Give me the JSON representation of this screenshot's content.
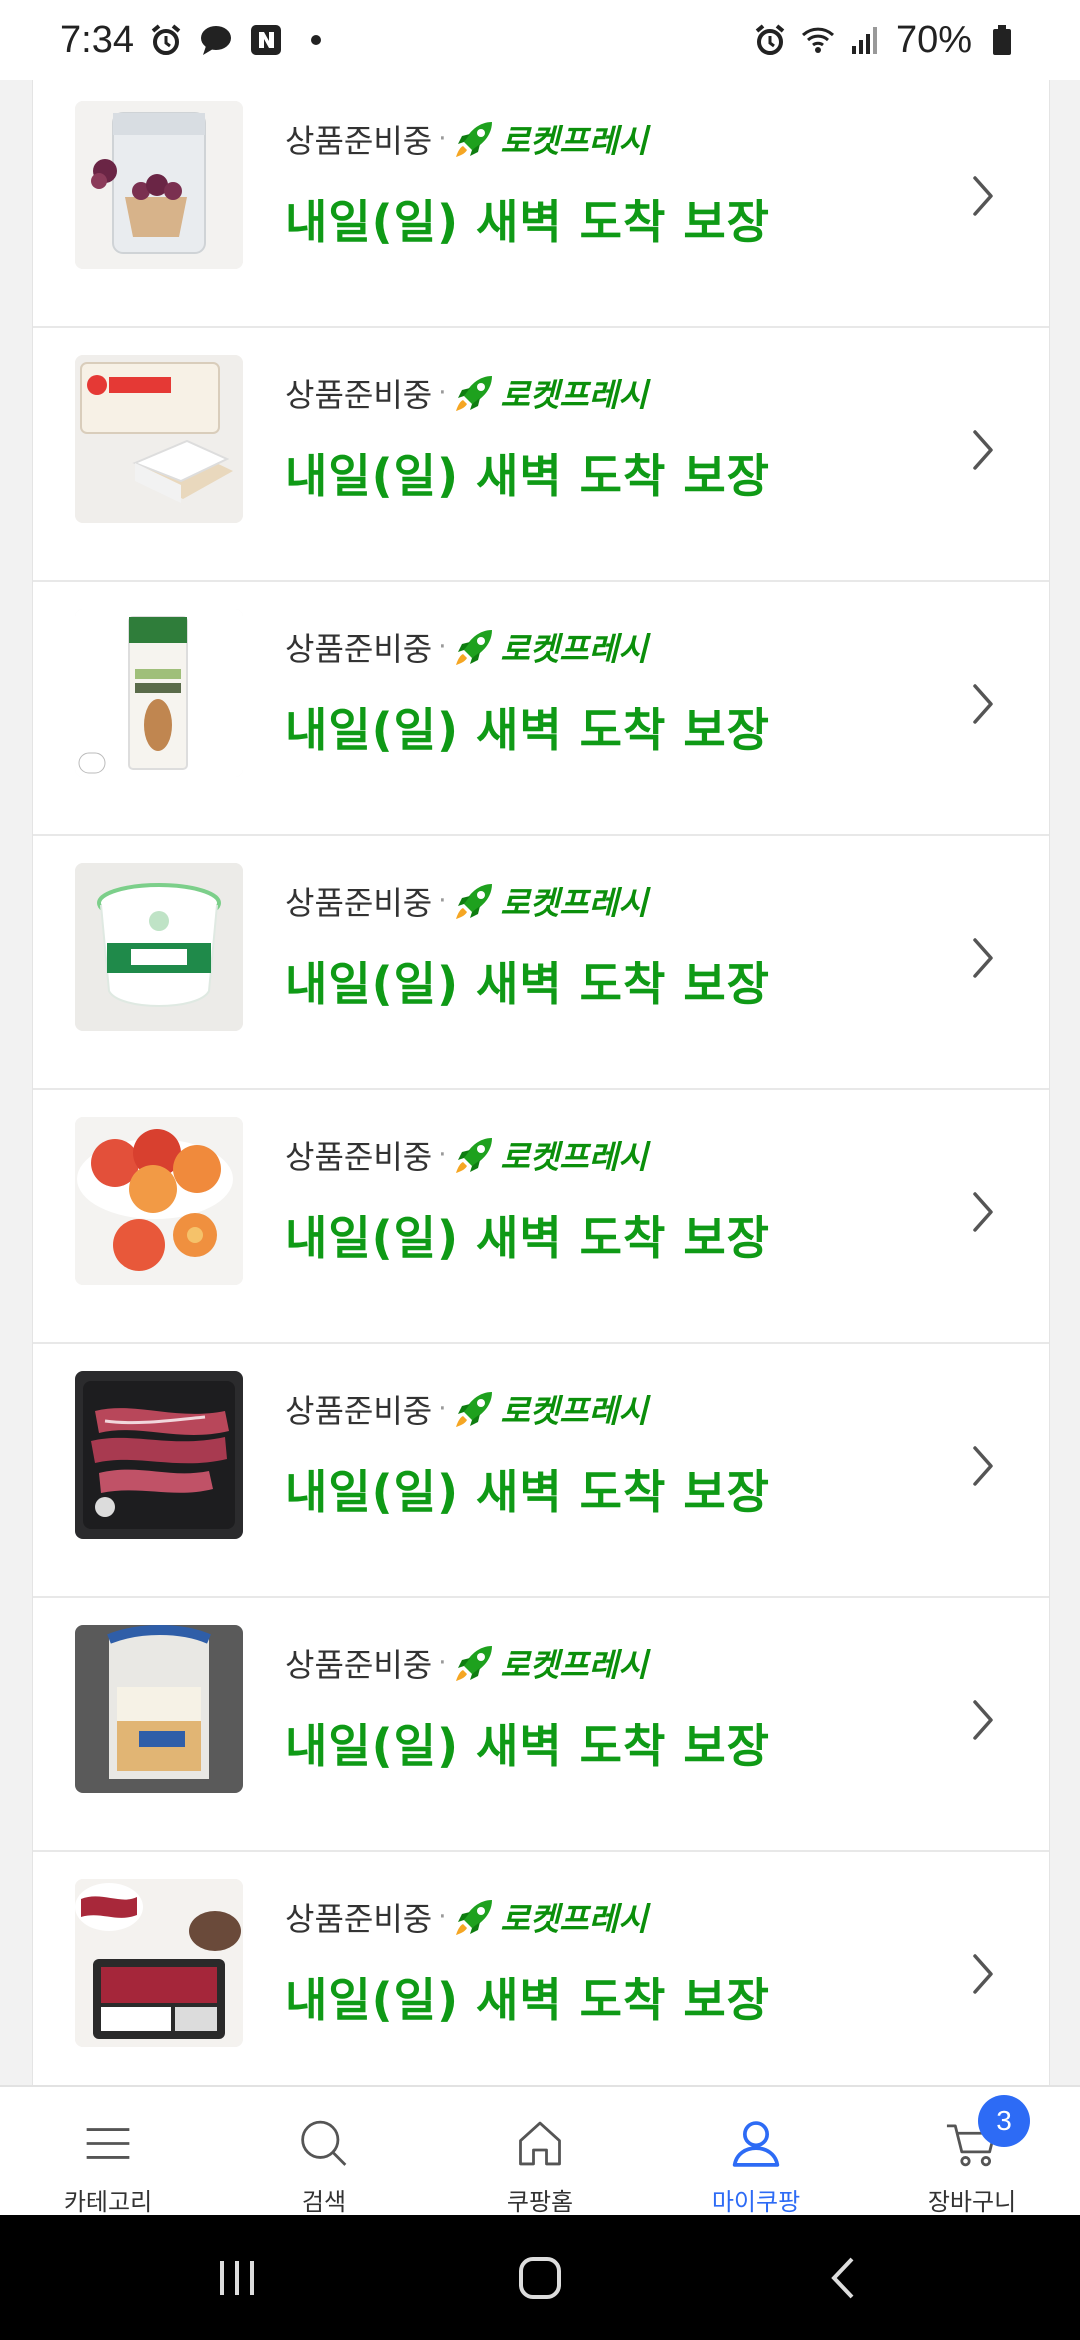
{
  "status_bar": {
    "time": "7:34",
    "battery": "70%"
  },
  "items": [
    {
      "status": "상품준비중",
      "badge": "로켓프레시",
      "delivery": "내일(일) 새벽 도착 보장",
      "thumb_icon": "rice-bag-product-image"
    },
    {
      "status": "상품준비중",
      "badge": "로켓프레시",
      "delivery": "내일(일) 새벽 도착 보장",
      "thumb_icon": "tofu-product-image"
    },
    {
      "status": "상품준비중",
      "badge": "로켓프레시",
      "delivery": "내일(일) 새벽 도착 보장",
      "thumb_icon": "almond-milk-product-image"
    },
    {
      "status": "상품준비중",
      "badge": "로켓프레시",
      "delivery": "내일(일) 새벽 도착 보장",
      "thumb_icon": "greek-yogurt-product-image"
    },
    {
      "status": "상품준비중",
      "badge": "로켓프레시",
      "delivery": "내일(일) 새벽 도착 보장",
      "thumb_icon": "peaches-product-image"
    },
    {
      "status": "상품준비중",
      "badge": "로켓프레시",
      "delivery": "내일(일) 새벽 도착 보장",
      "thumb_icon": "beef-slices-product-image"
    },
    {
      "status": "상품준비중",
      "badge": "로켓프레시",
      "delivery": "내일(일) 새벽 도착 보장",
      "thumb_icon": "milk-bread-product-image"
    },
    {
      "status": "상품준비중",
      "badge": "로켓프레시",
      "delivery": "내일(일) 새벽 도착 보장",
      "thumb_icon": "beef-pack-product-image"
    }
  ],
  "bottom_nav": {
    "category": "카테고리",
    "search": "검색",
    "home": "쿠팡홈",
    "my": "마이쿠팡",
    "cart": "장바구니",
    "cart_count": "3",
    "active": "my",
    "active_color": "#2d6bf5"
  },
  "colors": {
    "rocket_green": "#0f9a16"
  }
}
